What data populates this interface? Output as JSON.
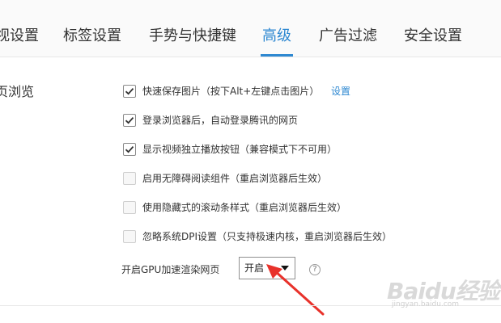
{
  "tabs": [
    {
      "label": "视设置"
    },
    {
      "label": "标签设置"
    },
    {
      "label": "手势与快捷键"
    },
    {
      "label": "高级",
      "active": true
    },
    {
      "label": "广告过滤"
    },
    {
      "label": "安全设置"
    }
  ],
  "section": {
    "title": "页浏览"
  },
  "options": [
    {
      "label": "快速保存图片（按下Alt+左键点击图片）",
      "checked": true,
      "link": "设置"
    },
    {
      "label": "登录浏览器后，自动登录腾讯的网页",
      "checked": true
    },
    {
      "label": "显示视频独立播放按钮（兼容模式下不可用）",
      "checked": true
    },
    {
      "label": "启用无障碍阅读组件（重启浏览器后生效）",
      "checked": false
    },
    {
      "label": "使用隐藏式的滚动条样式（重启浏览器后生效）",
      "checked": false
    },
    {
      "label": "忽略系统DPI设置（只支持极速内核，重启浏览器后生效）",
      "checked": false
    }
  ],
  "gpu": {
    "label": "开启GPU加速渲染网页",
    "value": "开启",
    "help": "?"
  },
  "colors": {
    "accent": "#2e88d1",
    "annotation": "#e8322b"
  },
  "watermark": {
    "brand": "Baidu经验",
    "url": "jingyan.baidu.com"
  }
}
